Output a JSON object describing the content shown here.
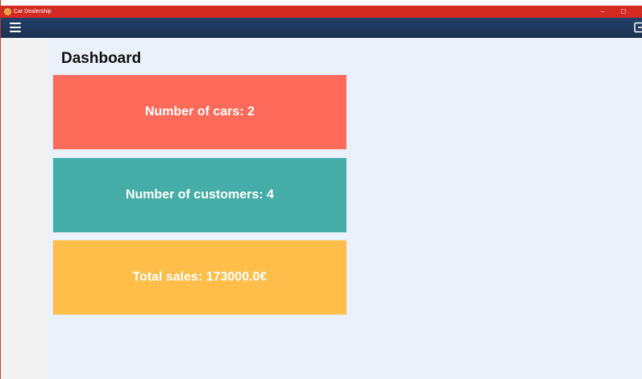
{
  "window": {
    "title": "Car Dealership",
    "controls": {
      "minimize": "–",
      "maximize": "☐",
      "close": "✕"
    }
  },
  "toolbar": {
    "menu_icon": "hamburger-menu-icon",
    "logout_icon": "logout-icon"
  },
  "main": {
    "title": "Dashboard",
    "cards": [
      {
        "label": "Number of cars: 2",
        "color": "#ff6b5b"
      },
      {
        "label": "Number of customers: 4",
        "color": "#45ada8"
      },
      {
        "label": "Total sales: 173000.0€",
        "color": "#ffbd4a"
      }
    ]
  },
  "colors": {
    "titlebar": "#d32a22",
    "toolbar": "#1f3a60",
    "sidebar": "#f2f2f2",
    "content_background": "#eaf1fa"
  }
}
